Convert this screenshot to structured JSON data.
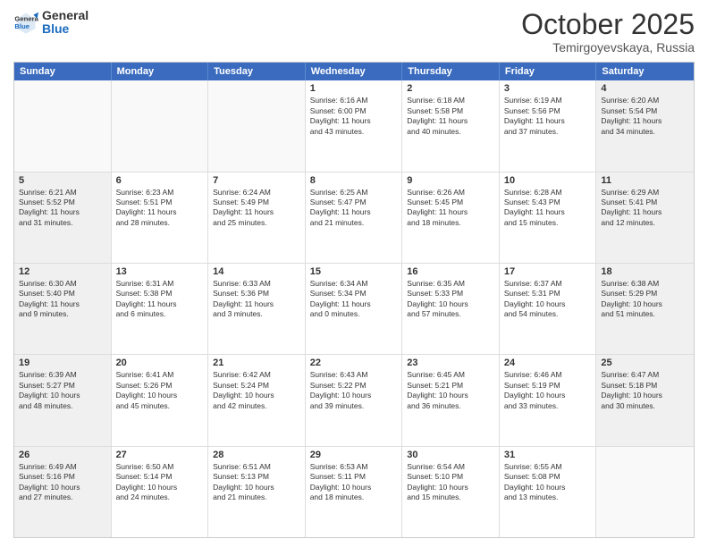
{
  "header": {
    "logo_general": "General",
    "logo_blue": "Blue",
    "month_title": "October 2025",
    "location": "Temirgoyevskaya, Russia"
  },
  "days_of_week": [
    "Sunday",
    "Monday",
    "Tuesday",
    "Wednesday",
    "Thursday",
    "Friday",
    "Saturday"
  ],
  "weeks": [
    [
      {
        "day": "",
        "text": "",
        "empty": true
      },
      {
        "day": "",
        "text": "",
        "empty": true
      },
      {
        "day": "",
        "text": "",
        "empty": true
      },
      {
        "day": "1",
        "text": "Sunrise: 6:16 AM\nSunset: 6:00 PM\nDaylight: 11 hours\nand 43 minutes.",
        "empty": false
      },
      {
        "day": "2",
        "text": "Sunrise: 6:18 AM\nSunset: 5:58 PM\nDaylight: 11 hours\nand 40 minutes.",
        "empty": false
      },
      {
        "day": "3",
        "text": "Sunrise: 6:19 AM\nSunset: 5:56 PM\nDaylight: 11 hours\nand 37 minutes.",
        "empty": false
      },
      {
        "day": "4",
        "text": "Sunrise: 6:20 AM\nSunset: 5:54 PM\nDaylight: 11 hours\nand 34 minutes.",
        "empty": false,
        "shaded": true
      }
    ],
    [
      {
        "day": "5",
        "text": "Sunrise: 6:21 AM\nSunset: 5:52 PM\nDaylight: 11 hours\nand 31 minutes.",
        "empty": false,
        "shaded": true
      },
      {
        "day": "6",
        "text": "Sunrise: 6:23 AM\nSunset: 5:51 PM\nDaylight: 11 hours\nand 28 minutes.",
        "empty": false
      },
      {
        "day": "7",
        "text": "Sunrise: 6:24 AM\nSunset: 5:49 PM\nDaylight: 11 hours\nand 25 minutes.",
        "empty": false
      },
      {
        "day": "8",
        "text": "Sunrise: 6:25 AM\nSunset: 5:47 PM\nDaylight: 11 hours\nand 21 minutes.",
        "empty": false
      },
      {
        "day": "9",
        "text": "Sunrise: 6:26 AM\nSunset: 5:45 PM\nDaylight: 11 hours\nand 18 minutes.",
        "empty": false
      },
      {
        "day": "10",
        "text": "Sunrise: 6:28 AM\nSunset: 5:43 PM\nDaylight: 11 hours\nand 15 minutes.",
        "empty": false
      },
      {
        "day": "11",
        "text": "Sunrise: 6:29 AM\nSunset: 5:41 PM\nDaylight: 11 hours\nand 12 minutes.",
        "empty": false,
        "shaded": true
      }
    ],
    [
      {
        "day": "12",
        "text": "Sunrise: 6:30 AM\nSunset: 5:40 PM\nDaylight: 11 hours\nand 9 minutes.",
        "empty": false,
        "shaded": true
      },
      {
        "day": "13",
        "text": "Sunrise: 6:31 AM\nSunset: 5:38 PM\nDaylight: 11 hours\nand 6 minutes.",
        "empty": false
      },
      {
        "day": "14",
        "text": "Sunrise: 6:33 AM\nSunset: 5:36 PM\nDaylight: 11 hours\nand 3 minutes.",
        "empty": false
      },
      {
        "day": "15",
        "text": "Sunrise: 6:34 AM\nSunset: 5:34 PM\nDaylight: 11 hours\nand 0 minutes.",
        "empty": false
      },
      {
        "day": "16",
        "text": "Sunrise: 6:35 AM\nSunset: 5:33 PM\nDaylight: 10 hours\nand 57 minutes.",
        "empty": false
      },
      {
        "day": "17",
        "text": "Sunrise: 6:37 AM\nSunset: 5:31 PM\nDaylight: 10 hours\nand 54 minutes.",
        "empty": false
      },
      {
        "day": "18",
        "text": "Sunrise: 6:38 AM\nSunset: 5:29 PM\nDaylight: 10 hours\nand 51 minutes.",
        "empty": false,
        "shaded": true
      }
    ],
    [
      {
        "day": "19",
        "text": "Sunrise: 6:39 AM\nSunset: 5:27 PM\nDaylight: 10 hours\nand 48 minutes.",
        "empty": false,
        "shaded": true
      },
      {
        "day": "20",
        "text": "Sunrise: 6:41 AM\nSunset: 5:26 PM\nDaylight: 10 hours\nand 45 minutes.",
        "empty": false
      },
      {
        "day": "21",
        "text": "Sunrise: 6:42 AM\nSunset: 5:24 PM\nDaylight: 10 hours\nand 42 minutes.",
        "empty": false
      },
      {
        "day": "22",
        "text": "Sunrise: 6:43 AM\nSunset: 5:22 PM\nDaylight: 10 hours\nand 39 minutes.",
        "empty": false
      },
      {
        "day": "23",
        "text": "Sunrise: 6:45 AM\nSunset: 5:21 PM\nDaylight: 10 hours\nand 36 minutes.",
        "empty": false
      },
      {
        "day": "24",
        "text": "Sunrise: 6:46 AM\nSunset: 5:19 PM\nDaylight: 10 hours\nand 33 minutes.",
        "empty": false
      },
      {
        "day": "25",
        "text": "Sunrise: 6:47 AM\nSunset: 5:18 PM\nDaylight: 10 hours\nand 30 minutes.",
        "empty": false,
        "shaded": true
      }
    ],
    [
      {
        "day": "26",
        "text": "Sunrise: 6:49 AM\nSunset: 5:16 PM\nDaylight: 10 hours\nand 27 minutes.",
        "empty": false,
        "shaded": true
      },
      {
        "day": "27",
        "text": "Sunrise: 6:50 AM\nSunset: 5:14 PM\nDaylight: 10 hours\nand 24 minutes.",
        "empty": false
      },
      {
        "day": "28",
        "text": "Sunrise: 6:51 AM\nSunset: 5:13 PM\nDaylight: 10 hours\nand 21 minutes.",
        "empty": false
      },
      {
        "day": "29",
        "text": "Sunrise: 6:53 AM\nSunset: 5:11 PM\nDaylight: 10 hours\nand 18 minutes.",
        "empty": false
      },
      {
        "day": "30",
        "text": "Sunrise: 6:54 AM\nSunset: 5:10 PM\nDaylight: 10 hours\nand 15 minutes.",
        "empty": false
      },
      {
        "day": "31",
        "text": "Sunrise: 6:55 AM\nSunset: 5:08 PM\nDaylight: 10 hours\nand 13 minutes.",
        "empty": false
      },
      {
        "day": "",
        "text": "",
        "empty": true,
        "shaded": true
      }
    ]
  ]
}
